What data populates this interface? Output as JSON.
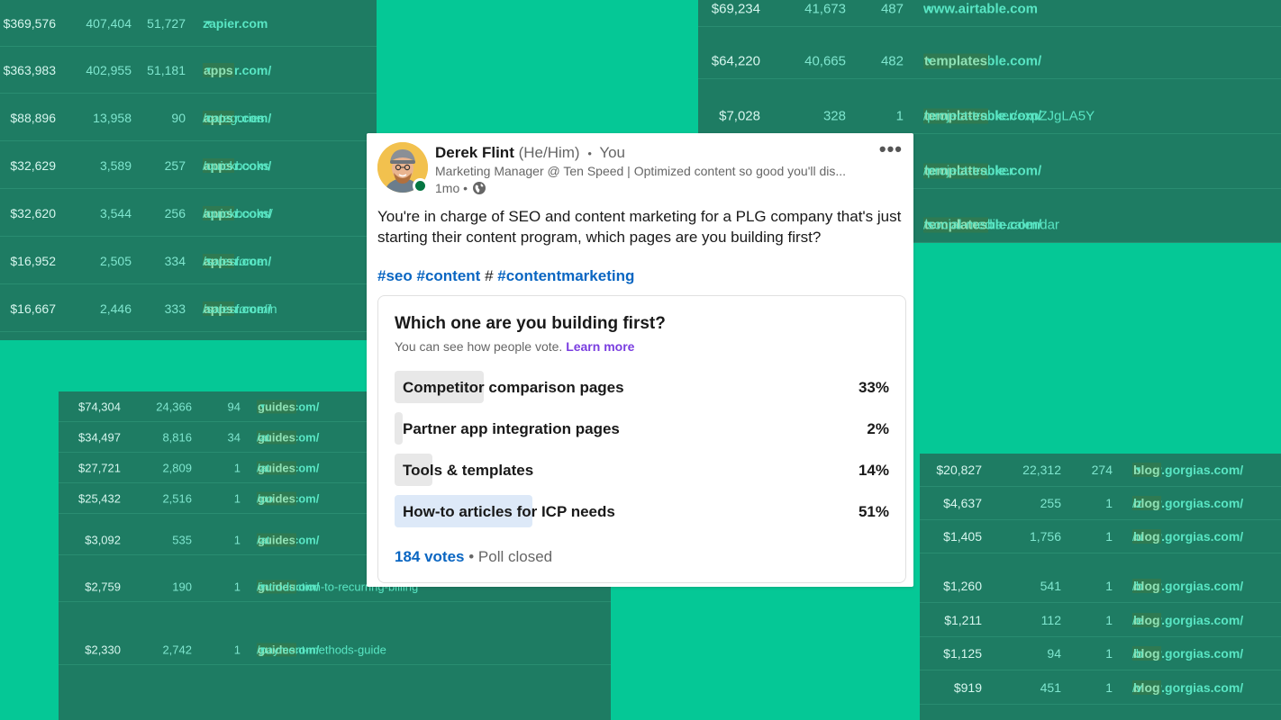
{
  "colors": {
    "background": "#05c896",
    "panel": "#1e7c63",
    "link": "#0a66c2",
    "accent_purple": "#7a3ee0"
  },
  "zapier_rows": [
    {
      "rev": "$369,576",
      "a": "407,404",
      "b": "51,727",
      "domain": "zapier.com",
      "seg": "",
      "rest": "",
      "arrow": "▾"
    },
    {
      "rev": "$363,983",
      "a": "402,955",
      "b": "51,181",
      "domain": "zapier.com/",
      "seg": "apps",
      "rest": "",
      "arrow": "▾"
    },
    {
      "rev": "$88,896",
      "a": "13,958",
      "b": "90",
      "domain": "zapier.com/",
      "seg": "apps",
      "rest": "/categories",
      "arrow": "▾"
    },
    {
      "rev": "$32,629",
      "a": "3,589",
      "b": "257",
      "domain": "zapier.com/",
      "seg": "apps",
      "rest": "/quickbooks",
      "arrow": ""
    },
    {
      "rev": "$32,620",
      "a": "3,544",
      "b": "256",
      "domain": "zapier.com/",
      "seg": "apps",
      "rest": "/quickbooks/",
      "arrow": ""
    },
    {
      "rev": "$16,952",
      "a": "2,505",
      "b": "334",
      "domain": "zapier.com/",
      "seg": "apps",
      "rest": "/salesforce",
      "arrow": "▾"
    },
    {
      "rev": "$16,667",
      "a": "2,446",
      "b": "333",
      "domain": "zapier.com/",
      "seg": "apps",
      "rest": "/salesforce/in",
      "arrow": ""
    }
  ],
  "airtable_rows": [
    {
      "rev": "$69,234",
      "a": "41,673",
      "b": "487",
      "domain": "www.airtable.com",
      "seg": "",
      "rest": "",
      "arrow": "▾"
    },
    {
      "rev": "$64,220",
      "a": "40,665",
      "b": "482",
      "domain": "www.airtable.com/",
      "seg": "templates",
      "rest": "",
      "arrow": "▾"
    },
    {
      "rev": "$7,028",
      "a": "328",
      "b": "1",
      "domain": "www.airtable.com/",
      "seg": "templates",
      "rest": "/project-tracker/expZJgLA5Y",
      "arrow": ""
    },
    {
      "rev": "",
      "a": "",
      "b": "",
      "domain": "www.airtable.com/",
      "seg": "templates",
      "rest": "/project-tracker",
      "arrow": "▾"
    },
    {
      "rev": "",
      "a": "",
      "b": "",
      "domain": "www.airtable.com/",
      "seg": "templates",
      "rest": "/social-media-calendar",
      "arrow": "▾"
    }
  ],
  "stripe_rows": [
    {
      "rev": "$74,304",
      "a": "24,366",
      "b": "94",
      "domain": "stripe.com/",
      "seg": "guides",
      "rest": "",
      "arrow": "▾"
    },
    {
      "rev": "$34,497",
      "a": "8,816",
      "b": "34",
      "domain": "stripe.com/",
      "seg": "guides",
      "rest": "/at",
      "arrow": ""
    },
    {
      "rev": "$27,721",
      "a": "2,809",
      "b": "1",
      "domain": "stripe.com/",
      "seg": "guides",
      "rest": "/at",
      "arrow": ""
    },
    {
      "rev": "$25,432",
      "a": "2,516",
      "b": "1",
      "domain": "stripe.com/",
      "seg": "guides",
      "rest": "/po",
      "arrow": ""
    },
    {
      "rev": "$3,092",
      "a": "535",
      "b": "1",
      "domain": "stripe.com/",
      "seg": "guides",
      "rest": "/at",
      "arrow": ""
    },
    {
      "rev": "$2,759",
      "a": "190",
      "b": "1",
      "domain": "stripe.com/",
      "seg": "guides",
      "rest": "/introduction-to-recurring-billing",
      "arrow": "▾"
    },
    {
      "rev": "$2,330",
      "a": "2,742",
      "b": "1",
      "domain": "stripe.com/",
      "seg": "guides",
      "rest": "/payment-methods-guide",
      "arrow": "▾"
    }
  ],
  "gorgias_rows": [
    {
      "rev": "$20,827",
      "a": "22,312",
      "b": "274",
      "domain": "www.gorgias.com/",
      "seg": "blog",
      "rest": "",
      "arrow": "▾"
    },
    {
      "rev": "$4,637",
      "a": "255",
      "b": "1",
      "domain": "www.gorgias.com/",
      "seg": "blog",
      "rest": "/z",
      "arrow": ""
    },
    {
      "rev": "$1,405",
      "a": "1,756",
      "b": "1",
      "domain": "www.gorgias.com/",
      "seg": "blog",
      "rest": "/u",
      "arrow": ""
    },
    {
      "rev": "$1,260",
      "a": "541",
      "b": "1",
      "domain": "www.gorgias.com/",
      "seg": "blog",
      "rest": "/b",
      "arrow": ""
    },
    {
      "rev": "$1,211",
      "a": "112",
      "b": "1",
      "domain": "www.gorgias.com/",
      "seg": "blog",
      "rest": "/e",
      "arrow": ""
    },
    {
      "rev": "$1,125",
      "a": "94",
      "b": "1",
      "domain": "www.gorgias.com/",
      "seg": "blog",
      "rest": "/b",
      "arrow": ""
    },
    {
      "rev": "$919",
      "a": "451",
      "b": "1",
      "domain": "www.gorgias.com/",
      "seg": "blog",
      "rest": "/v",
      "arrow": ""
    }
  ],
  "post": {
    "author": "Derek Flint",
    "pronouns": "(He/Him)",
    "separator": "•",
    "relation": "You",
    "headline": "Marketing Manager @ Ten Speed | Optimized content so good you'll dis...",
    "time": "1mo •",
    "more_label": "•••",
    "body": "You're in charge of SEO and content marketing for a PLG company that's just starting their content program, which pages are you building first?",
    "tags": [
      "#seo",
      "#content",
      "#",
      "#contentmarketing"
    ]
  },
  "poll": {
    "question": "Which one are you building first?",
    "subtitle": "You can see how people vote.",
    "learn_more": "Learn more",
    "options": [
      {
        "label": "Competitor comparison pages",
        "pct": "33%",
        "share": 0.33
      },
      {
        "label": "Partner app integration pages",
        "pct": "2%",
        "share": 0.02
      },
      {
        "label": "Tools & templates",
        "pct": "14%",
        "share": 0.14
      },
      {
        "label": "How-to articles for ICP needs",
        "pct": "51%",
        "share": 0.51
      }
    ],
    "votes": "184 votes",
    "status": "• Poll closed"
  }
}
